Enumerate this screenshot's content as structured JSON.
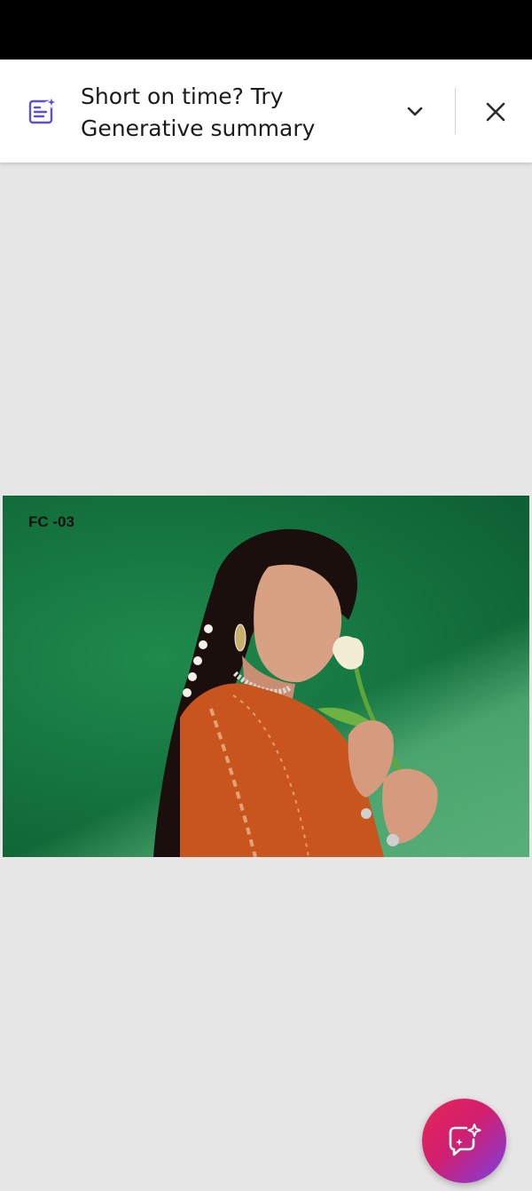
{
  "banner": {
    "line1": "Short on time? Try",
    "line2": "Generative summary",
    "icon": "generative-summary-icon",
    "expand_icon": "chevron-down-icon",
    "close_icon": "close-icon",
    "accent_color": "#5a4fd6"
  },
  "document": {
    "image_label": "FC -03",
    "background_color": "#e6e6e6"
  },
  "fab": {
    "icon": "ai-assistant-chat-icon",
    "gradient_start": "#e8265a",
    "gradient_end": "#7b3fe4"
  }
}
